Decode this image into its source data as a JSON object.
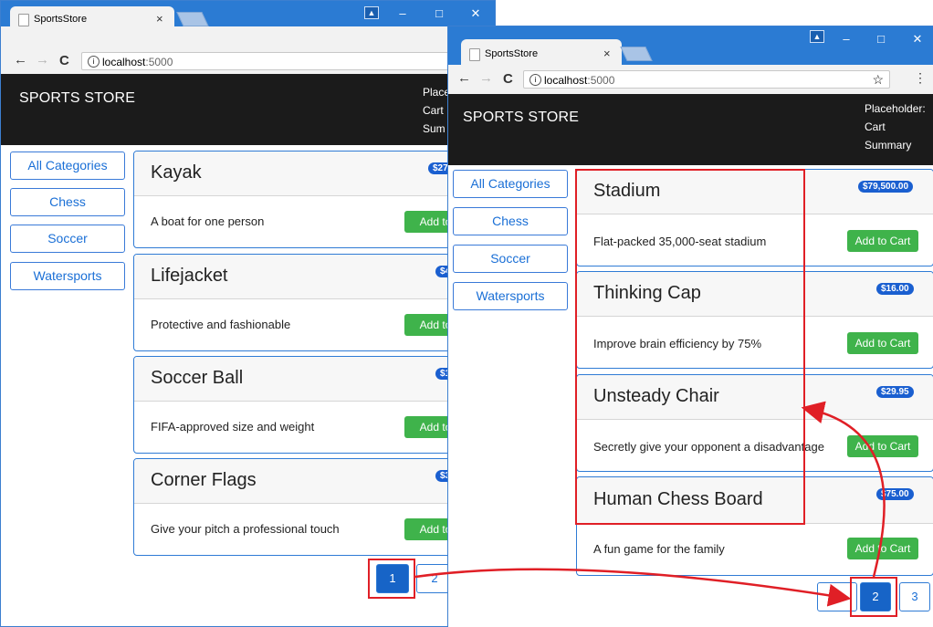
{
  "app": {
    "tab_title": "SportsStore",
    "tab_close": "×",
    "url_host": "localhost",
    "url_port": ":5000",
    "info_icon": "i",
    "bookmark_star": "☆",
    "menu_dots": "⋮",
    "win_minimize": "–",
    "win_maximize": "□",
    "win_close": "✕",
    "nav_back": "←",
    "nav_forward": "→",
    "nav_reload": "C"
  },
  "left_window": {
    "brand": "SPORTS STORE",
    "cart_summary_lines": [
      "Place",
      "Cart",
      "Sum"
    ],
    "categories": [
      "All Categories",
      "Chess",
      "Soccer",
      "Watersports"
    ],
    "products": [
      {
        "name": "Kayak",
        "price": "$27",
        "description": "A boat for one person",
        "button": "Add to C"
      },
      {
        "name": "Lifejacket",
        "price": "$4",
        "description": "Protective and fashionable",
        "button": "Add to C"
      },
      {
        "name": "Soccer Ball",
        "price": "$1",
        "description": "FIFA-approved size and weight",
        "button": "Add to C"
      },
      {
        "name": "Corner Flags",
        "price": "$3",
        "description": "Give your pitch a professional touch",
        "button": "Add to C"
      }
    ],
    "pages": [
      "1",
      "2"
    ],
    "active_page": "1"
  },
  "right_window": {
    "brand": "SPORTS STORE",
    "cart_summary_lines": [
      "Placeholder:",
      "Cart",
      "Summary"
    ],
    "categories": [
      "All Categories",
      "Chess",
      "Soccer",
      "Watersports"
    ],
    "products": [
      {
        "name": "Stadium",
        "price": "$79,500.00",
        "description": "Flat-packed 35,000-seat stadium",
        "button": "Add to Cart"
      },
      {
        "name": "Thinking Cap",
        "price": "$16.00",
        "description": "Improve brain efficiency by 75%",
        "button": "Add to Cart"
      },
      {
        "name": "Unsteady Chair",
        "price": "$29.95",
        "description": "Secretly give your opponent a disadvantage",
        "button": "Add to Cart"
      },
      {
        "name": "Human Chess Board",
        "price": "$75.00",
        "description": "A fun game for the family",
        "button": "Add to Cart"
      }
    ],
    "pages": [
      "2",
      "3"
    ],
    "active_page": "2"
  },
  "colors": {
    "annotation_red": "#e01f26",
    "primary_blue": "#1a6fd6",
    "success_green": "#3fb34b",
    "navbar_black": "#1b1b1b"
  }
}
